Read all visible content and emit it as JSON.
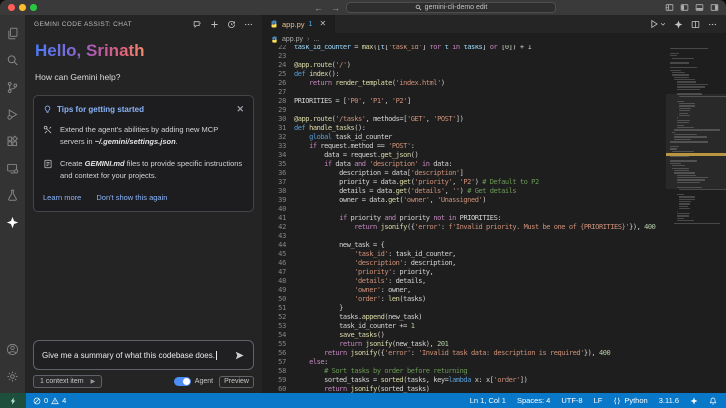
{
  "title_bar": {
    "search_label": "gemini-cli-demo edit"
  },
  "activity_bar": {
    "items": [
      "explorer",
      "search",
      "source-control",
      "run-and-debug",
      "extensions",
      "remote-explorer",
      "testing",
      "gemini-code-assist",
      "accounts",
      "settings"
    ]
  },
  "chat": {
    "header": "GEMINI CODE ASSIST: CHAT",
    "greeting": "Hello, Srinath",
    "subtitle": "How can Gemini help?",
    "tips": {
      "title": "Tips for getting started",
      "items": [
        {
          "lead": "Extend the agent's abilities by adding new MCP servers in ",
          "emphasis": "~/.gemini/settings.json",
          "tail": "."
        },
        {
          "lead": "Create ",
          "emphasis": "GEMINI.md",
          "tail": " files to provide specific instructions and context for your projects."
        }
      ],
      "links": [
        "Learn more",
        "Don't show this again"
      ]
    },
    "input": {
      "value": "Give me a summary of what this codebase does.",
      "context_button": "1 context item",
      "toggle_label": "Agent",
      "badge": "Preview"
    }
  },
  "editor": {
    "tab": {
      "name": "app.py",
      "badge": "1"
    },
    "breadcrumb": {
      "file": "app.py",
      "path_suffix": "..."
    },
    "code": [
      {
        "n": 22,
        "t": [
          [
            "task_id_counter",
            "v"
          ],
          [
            " = ",
            "p"
          ],
          [
            "max",
            "f"
          ],
          [
            "([",
            "p"
          ],
          [
            "t",
            "v"
          ],
          [
            "[",
            "p"
          ],
          [
            "'task_id'",
            "s"
          ],
          [
            "] ",
            "p"
          ],
          [
            "for",
            "c"
          ],
          [
            " ",
            "p"
          ],
          [
            "t",
            "v"
          ],
          [
            " ",
            "p"
          ],
          [
            "in",
            "c"
          ],
          [
            " ",
            "p"
          ],
          [
            "tasks",
            "v"
          ],
          [
            "] ",
            "p"
          ],
          [
            "or",
            "c"
          ],
          [
            " [",
            "p"
          ],
          [
            "0",
            "n"
          ],
          [
            "]) + ",
            "p"
          ],
          [
            "1",
            "n"
          ]
        ]
      },
      {
        "n": 23,
        "t": []
      },
      {
        "n": 24,
        "t": [
          [
            "@app.route",
            "f"
          ],
          [
            "(",
            "p"
          ],
          [
            "'/'",
            "s"
          ],
          [
            ")",
            "p"
          ]
        ]
      },
      {
        "n": 25,
        "t": [
          [
            "def",
            "k"
          ],
          [
            " ",
            "p"
          ],
          [
            "index",
            "f"
          ],
          [
            "():",
            "p"
          ]
        ]
      },
      {
        "n": 26,
        "t": [
          [
            "    ",
            "p"
          ],
          [
            "return",
            "c"
          ],
          [
            " ",
            "p"
          ],
          [
            "render_template",
            "f"
          ],
          [
            "(",
            "p"
          ],
          [
            "'index.html'",
            "s"
          ],
          [
            ")",
            "p"
          ]
        ]
      },
      {
        "n": 27,
        "t": []
      },
      {
        "n": 28,
        "t": [
          [
            "PRIORITIES = [",
            "p"
          ],
          [
            "'P0'",
            "s"
          ],
          [
            ", ",
            "p"
          ],
          [
            "'P1'",
            "s"
          ],
          [
            ", ",
            "p"
          ],
          [
            "'P2'",
            "s"
          ],
          [
            "]",
            "p"
          ]
        ]
      },
      {
        "n": 29,
        "t": []
      },
      {
        "n": 30,
        "t": [
          [
            "@app.route",
            "f"
          ],
          [
            "(",
            "p"
          ],
          [
            "'/tasks'",
            "s"
          ],
          [
            ", methods=[",
            "p"
          ],
          [
            "'GET'",
            "s"
          ],
          [
            ", ",
            "p"
          ],
          [
            "'POST'",
            "s"
          ],
          [
            "])",
            "p"
          ]
        ]
      },
      {
        "n": 31,
        "t": [
          [
            "def",
            "k"
          ],
          [
            " ",
            "p"
          ],
          [
            "handle_tasks",
            "f"
          ],
          [
            "():",
            "p"
          ]
        ]
      },
      {
        "n": 32,
        "t": [
          [
            "    ",
            "p"
          ],
          [
            "global",
            "k"
          ],
          [
            " task_id_counter",
            "p"
          ]
        ]
      },
      {
        "n": 33,
        "t": [
          [
            "    ",
            "p"
          ],
          [
            "if",
            "c"
          ],
          [
            " request.method == ",
            "p"
          ],
          [
            "'POST'",
            "s"
          ],
          [
            ":",
            "p"
          ]
        ]
      },
      {
        "n": 34,
        "t": [
          [
            "        data = request.",
            "p"
          ],
          [
            "get_json",
            "f"
          ],
          [
            "()",
            "p"
          ]
        ]
      },
      {
        "n": 35,
        "t": [
          [
            "        ",
            "p"
          ],
          [
            "if",
            "c"
          ],
          [
            " data ",
            "p"
          ],
          [
            "and",
            "c"
          ],
          [
            " ",
            "p"
          ],
          [
            "'description'",
            "s"
          ],
          [
            " ",
            "p"
          ],
          [
            "in",
            "c"
          ],
          [
            " data:",
            "p"
          ]
        ]
      },
      {
        "n": 36,
        "t": [
          [
            "            description = data[",
            "p"
          ],
          [
            "'description'",
            "s"
          ],
          [
            "]",
            "p"
          ]
        ]
      },
      {
        "n": 37,
        "t": [
          [
            "            priority = data.",
            "p"
          ],
          [
            "get",
            "f"
          ],
          [
            "(",
            "p"
          ],
          [
            "'priority'",
            "s"
          ],
          [
            ", ",
            "p"
          ],
          [
            "'P2'",
            "s"
          ],
          [
            ") ",
            "p"
          ],
          [
            "# Default to P2",
            "m"
          ]
        ]
      },
      {
        "n": 38,
        "t": [
          [
            "            details = data.",
            "p"
          ],
          [
            "get",
            "f"
          ],
          [
            "(",
            "p"
          ],
          [
            "'details'",
            "s"
          ],
          [
            ", ",
            "p"
          ],
          [
            "''",
            "s"
          ],
          [
            ") ",
            "p"
          ],
          [
            "# Get details",
            "m"
          ]
        ]
      },
      {
        "n": 39,
        "t": [
          [
            "            owner = data.",
            "p"
          ],
          [
            "get",
            "f"
          ],
          [
            "(",
            "p"
          ],
          [
            "'owner'",
            "s"
          ],
          [
            ", ",
            "p"
          ],
          [
            "'Unassigned'",
            "s"
          ],
          [
            ")",
            "p"
          ]
        ]
      },
      {
        "n": 40,
        "t": []
      },
      {
        "n": 41,
        "t": [
          [
            "            ",
            "p"
          ],
          [
            "if",
            "c"
          ],
          [
            " priority ",
            "p"
          ],
          [
            "and",
            "c"
          ],
          [
            " priority ",
            "p"
          ],
          [
            "not",
            "c"
          ],
          [
            " ",
            "p"
          ],
          [
            "in",
            "c"
          ],
          [
            " PRIORITIES:",
            "p"
          ]
        ]
      },
      {
        "n": 42,
        "t": [
          [
            "                ",
            "p"
          ],
          [
            "return",
            "c"
          ],
          [
            " ",
            "p"
          ],
          [
            "jsonify",
            "f"
          ],
          [
            "({",
            "p"
          ],
          [
            "'error'",
            "s"
          ],
          [
            ": ",
            "p"
          ],
          [
            "f'Invalid priority. Must be one of {PRIORITIES}'",
            "s"
          ],
          [
            "}), ",
            "p"
          ],
          [
            "400",
            "n"
          ]
        ]
      },
      {
        "n": 43,
        "t": []
      },
      {
        "n": 44,
        "t": [
          [
            "            new_task = {",
            "p"
          ]
        ]
      },
      {
        "n": 45,
        "t": [
          [
            "                ",
            "p"
          ],
          [
            "'task_id'",
            "s"
          ],
          [
            ": task_id_counter,",
            "p"
          ]
        ]
      },
      {
        "n": 46,
        "t": [
          [
            "                ",
            "p"
          ],
          [
            "'description'",
            "s"
          ],
          [
            ": description,",
            "p"
          ]
        ]
      },
      {
        "n": 47,
        "t": [
          [
            "                ",
            "p"
          ],
          [
            "'priority'",
            "s"
          ],
          [
            ": priority,",
            "p"
          ]
        ]
      },
      {
        "n": 48,
        "t": [
          [
            "                ",
            "p"
          ],
          [
            "'details'",
            "s"
          ],
          [
            ": details,",
            "p"
          ]
        ]
      },
      {
        "n": 49,
        "t": [
          [
            "                ",
            "p"
          ],
          [
            "'owner'",
            "s"
          ],
          [
            ": owner,",
            "p"
          ]
        ]
      },
      {
        "n": 50,
        "t": [
          [
            "                ",
            "p"
          ],
          [
            "'order'",
            "s"
          ],
          [
            ": ",
            "p"
          ],
          [
            "len",
            "f"
          ],
          [
            "(tasks)",
            "p"
          ]
        ]
      },
      {
        "n": 51,
        "t": [
          [
            "            }",
            "p"
          ]
        ]
      },
      {
        "n": 52,
        "t": [
          [
            "            tasks.",
            "p"
          ],
          [
            "append",
            "f"
          ],
          [
            "(new_task)",
            "p"
          ]
        ]
      },
      {
        "n": 53,
        "t": [
          [
            "            task_id_counter += ",
            "p"
          ],
          [
            "1",
            "n"
          ]
        ]
      },
      {
        "n": 54,
        "t": [
          [
            "            ",
            "p"
          ],
          [
            "save_tasks",
            "f"
          ],
          [
            "()",
            "p"
          ]
        ]
      },
      {
        "n": 55,
        "t": [
          [
            "            ",
            "p"
          ],
          [
            "return",
            "c"
          ],
          [
            " ",
            "p"
          ],
          [
            "jsonify",
            "f"
          ],
          [
            "(new_task), ",
            "p"
          ],
          [
            "201",
            "n"
          ]
        ]
      },
      {
        "n": 56,
        "t": [
          [
            "        ",
            "p"
          ],
          [
            "return",
            "c"
          ],
          [
            " ",
            "p"
          ],
          [
            "jsonify",
            "f"
          ],
          [
            "({",
            "p"
          ],
          [
            "'error'",
            "s"
          ],
          [
            ": ",
            "p"
          ],
          [
            "'Invalid task data: description is required'",
            "s"
          ],
          [
            "}), ",
            "p"
          ],
          [
            "400",
            "n"
          ]
        ]
      },
      {
        "n": 57,
        "t": [
          [
            "    ",
            "p"
          ],
          [
            "else",
            "c"
          ],
          [
            ":",
            "p"
          ]
        ]
      },
      {
        "n": 58,
        "t": [
          [
            "        ",
            "p"
          ],
          [
            "# Sort tasks by order before returning",
            "m"
          ]
        ]
      },
      {
        "n": 59,
        "t": [
          [
            "        sorted_tasks = ",
            "p"
          ],
          [
            "sorted",
            "f"
          ],
          [
            "(tasks, key=",
            "p"
          ],
          [
            "lambda",
            "k"
          ],
          [
            " x: x[",
            "p"
          ],
          [
            "'order'",
            "s"
          ],
          [
            "])",
            "p"
          ]
        ]
      },
      {
        "n": 60,
        "t": [
          [
            "        ",
            "p"
          ],
          [
            "return",
            "c"
          ],
          [
            " ",
            "p"
          ],
          [
            "jsonify",
            "f"
          ],
          [
            "(sorted_tasks)",
            "p"
          ]
        ]
      }
    ]
  },
  "status_bar": {
    "errors": "0",
    "warnings": "4",
    "right": {
      "ln_col": "Ln 1, Col 1",
      "spaces": "Spaces: 4",
      "encoding": "UTF-8",
      "eol": "LF",
      "language": "Python",
      "python_version": "3.11.6"
    }
  },
  "colors": {
    "accent_blue": "#4c8df6",
    "status_bar": "#0a78c8",
    "greeting_gradient": [
      "#4a7bf7",
      "#7d6bd8",
      "#b65aa8",
      "#e0607c",
      "#f08a6b"
    ],
    "modified_tab": "#e2c08d"
  }
}
